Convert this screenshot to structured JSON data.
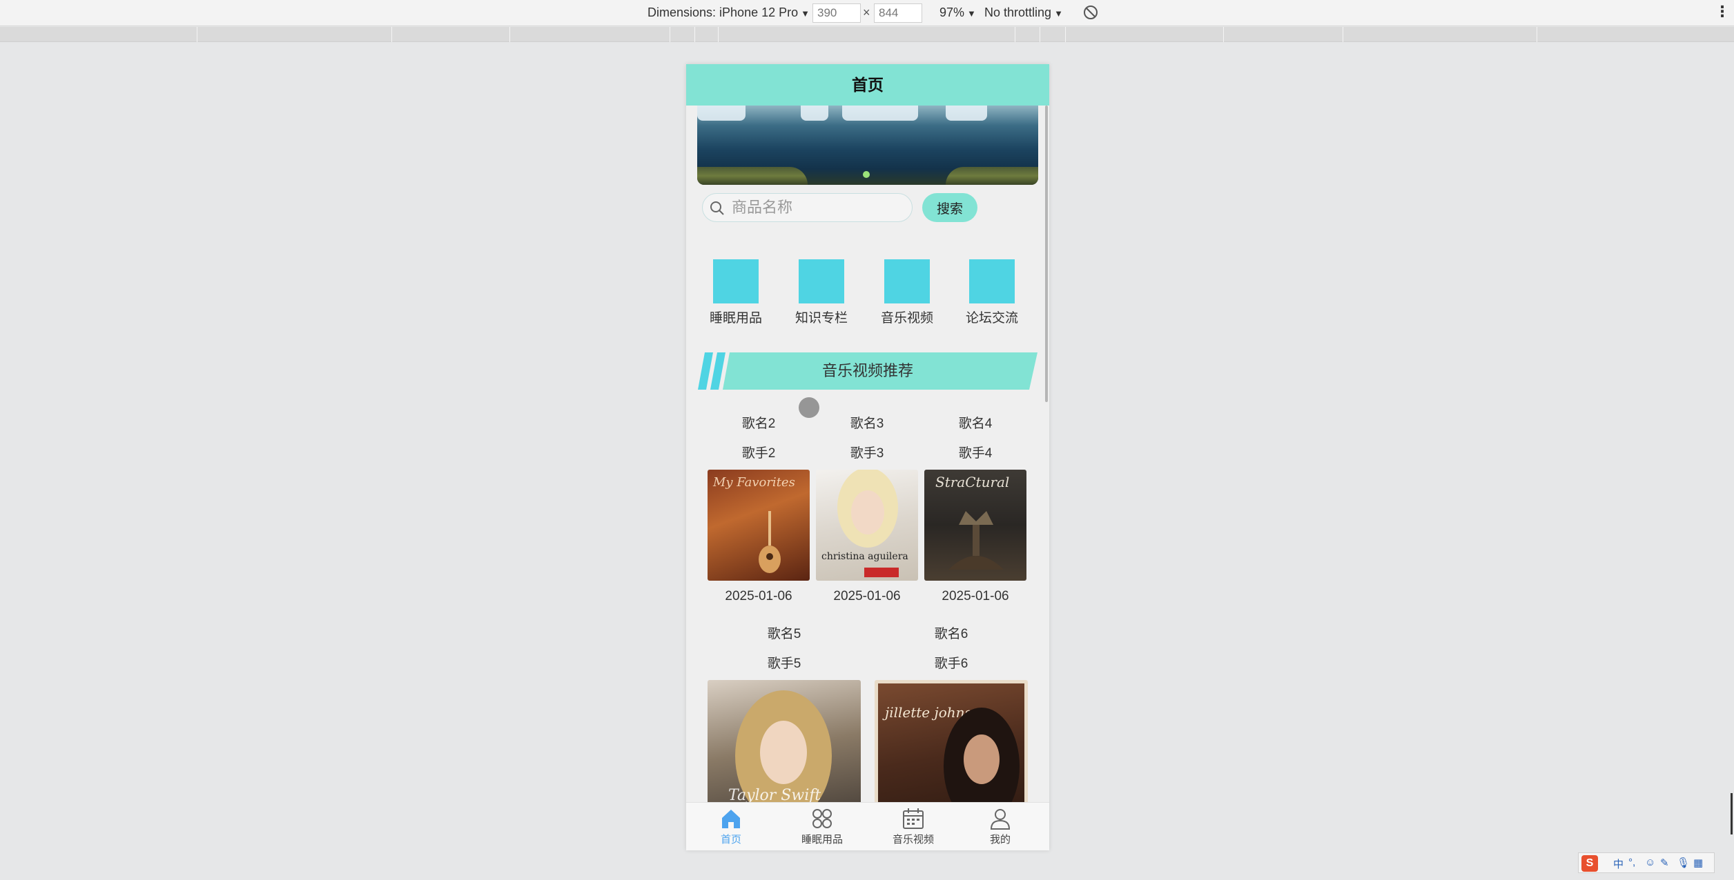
{
  "devtools": {
    "dimensions_label": "Dimensions: iPhone 12 Pro",
    "width": "390",
    "times": "×",
    "height": "844",
    "zoom": "97%",
    "throttling": "No throttling"
  },
  "app": {
    "header_title": "首页",
    "search": {
      "placeholder": "商品名称",
      "button_label": "搜索"
    },
    "categories": [
      {
        "label": "睡眠用品"
      },
      {
        "label": "知识专栏"
      },
      {
        "label": "音乐视频"
      },
      {
        "label": "论坛交流"
      }
    ],
    "section_title": "音乐视频推荐",
    "songs_row1": [
      {
        "title": "歌名2",
        "artist": "歌手2",
        "date": "2025-01-06",
        "cover_text": "My Favorites"
      },
      {
        "title": "歌名3",
        "artist": "歌手3",
        "date": "2025-01-06",
        "cover_text": "christina aguilera"
      },
      {
        "title": "歌名4",
        "artist": "歌手4",
        "date": "2025-01-06",
        "cover_text": "StraCtural"
      }
    ],
    "songs_row2": [
      {
        "title": "歌名5",
        "artist": "歌手5",
        "cover_text": "Taylor Swift"
      },
      {
        "title": "歌名6",
        "artist": "歌手6",
        "cover_text": "jillette johnson"
      }
    ],
    "tabbar": [
      {
        "label": "首页",
        "icon": "home-icon",
        "active": true
      },
      {
        "label": "睡眠用品",
        "icon": "apps-icon",
        "active": false
      },
      {
        "label": "音乐视频",
        "icon": "calendar-icon",
        "active": false
      },
      {
        "label": "我的",
        "icon": "user-icon",
        "active": false
      }
    ],
    "colors": {
      "accent": "#82e3d4",
      "category_tile": "#4fd4e3",
      "tab_active": "#4da3ee"
    }
  },
  "ime": {
    "logo": "S",
    "mode": "中"
  }
}
